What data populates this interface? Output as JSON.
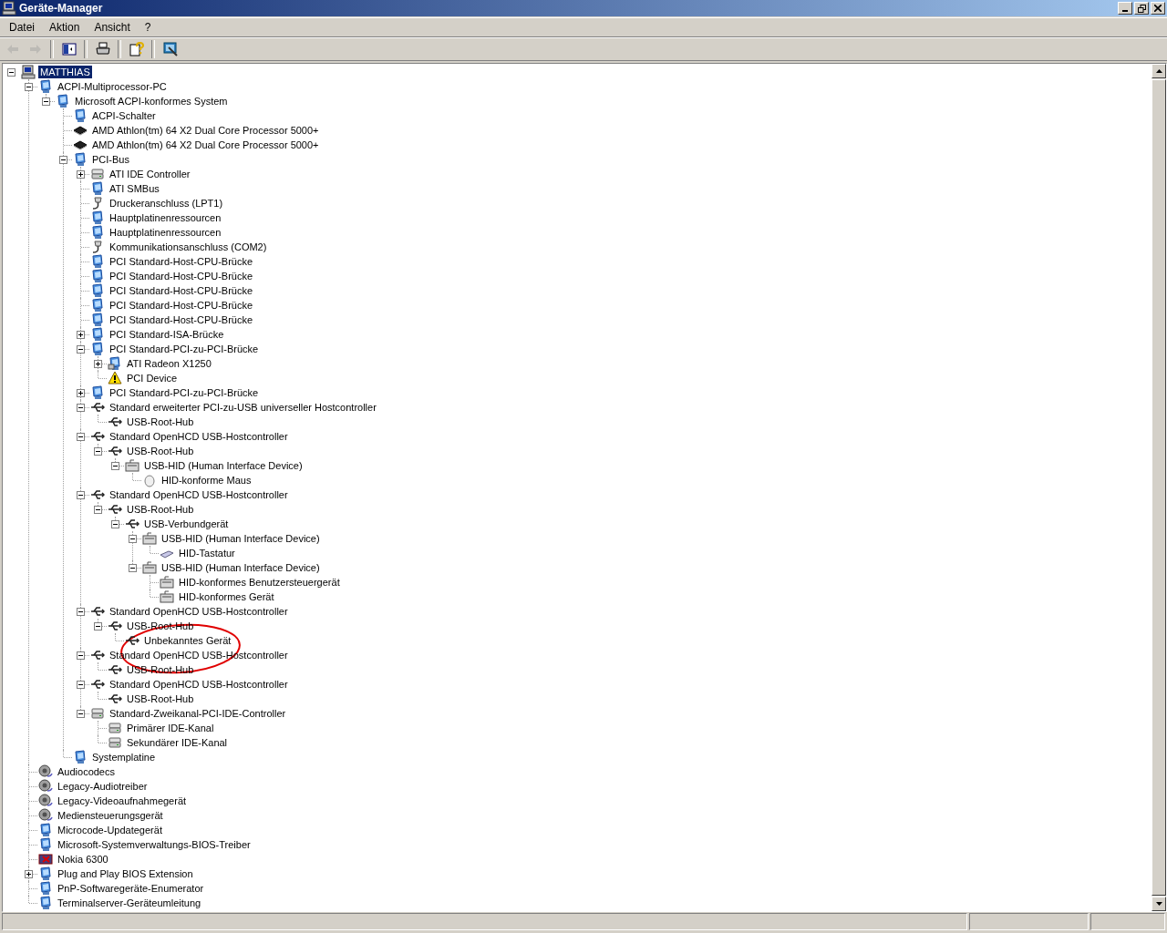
{
  "window": {
    "title": "Geräte-Manager"
  },
  "menu": [
    "Datei",
    "Aktion",
    "Ansicht",
    "?"
  ],
  "toolbar": [
    {
      "kind": "back",
      "disabled": true
    },
    {
      "kind": "forward",
      "disabled": true
    },
    {
      "kind": "tree",
      "disabled": false
    },
    {
      "kind": "print",
      "disabled": false
    },
    {
      "kind": "help",
      "disabled": false
    },
    {
      "kind": "scan",
      "disabled": false
    }
  ],
  "tree": [
    {
      "label": "MATTHIAS",
      "kind": "computer",
      "selected": true,
      "expanded": true,
      "children": [
        {
          "label": "ACPI-Multiprocessor-PC",
          "kind": "device",
          "selected": false,
          "expanded": true,
          "children": [
            {
              "label": "Microsoft ACPI-konformes System",
              "kind": "device",
              "selected": false,
              "expanded": true,
              "children": [
                {
                  "label": "ACPI-Schalter",
                  "kind": "device",
                  "selected": false
                },
                {
                  "label": "AMD Athlon(tm) 64 X2 Dual Core Processor 5000+",
                  "kind": "cpu",
                  "selected": false
                },
                {
                  "label": "AMD Athlon(tm) 64 X2 Dual Core Processor 5000+",
                  "kind": "cpu",
                  "selected": false
                },
                {
                  "label": "PCI-Bus",
                  "kind": "device",
                  "selected": false,
                  "expanded": true,
                  "children": [
                    {
                      "label": "ATI IDE Controller",
                      "kind": "ide",
                      "selected": false,
                      "expanded": false
                    },
                    {
                      "label": "ATI SMBus",
                      "kind": "device",
                      "selected": false
                    },
                    {
                      "label": "Druckeranschluss (LPT1)",
                      "kind": "port",
                      "selected": false
                    },
                    {
                      "label": "Hauptplatinenressourcen",
                      "kind": "device",
                      "selected": false
                    },
                    {
                      "label": "Hauptplatinenressourcen",
                      "kind": "device",
                      "selected": false
                    },
                    {
                      "label": "Kommunikationsanschluss (COM2)",
                      "kind": "port",
                      "selected": false
                    },
                    {
                      "label": "PCI Standard-Host-CPU-Brücke",
                      "kind": "device",
                      "selected": false
                    },
                    {
                      "label": "PCI Standard-Host-CPU-Brücke",
                      "kind": "device",
                      "selected": false
                    },
                    {
                      "label": "PCI Standard-Host-CPU-Brücke",
                      "kind": "device",
                      "selected": false
                    },
                    {
                      "label": "PCI Standard-Host-CPU-Brücke",
                      "kind": "device",
                      "selected": false
                    },
                    {
                      "label": "PCI Standard-Host-CPU-Brücke",
                      "kind": "device",
                      "selected": false
                    },
                    {
                      "label": "PCI Standard-ISA-Brücke",
                      "kind": "device",
                      "selected": false,
                      "expanded": false
                    },
                    {
                      "label": "PCI Standard-PCI-zu-PCI-Brücke",
                      "kind": "device",
                      "selected": false,
                      "expanded": true,
                      "children": [
                        {
                          "label": "ATI Radeon X1250",
                          "kind": "display",
                          "selected": false,
                          "expanded": false
                        },
                        {
                          "label": "PCI Device",
                          "kind": "warning",
                          "selected": false
                        }
                      ]
                    },
                    {
                      "label": "PCI Standard-PCI-zu-PCI-Brücke",
                      "kind": "device",
                      "selected": false,
                      "expanded": false
                    },
                    {
                      "label": "Standard erweiterter PCI-zu-USB universeller Hostcontroller",
                      "kind": "usb",
                      "selected": false,
                      "expanded": true,
                      "children": [
                        {
                          "label": "USB-Root-Hub",
                          "kind": "usb",
                          "selected": false
                        }
                      ]
                    },
                    {
                      "label": "Standard OpenHCD USB-Hostcontroller",
                      "kind": "usb",
                      "selected": false,
                      "expanded": true,
                      "children": [
                        {
                          "label": "USB-Root-Hub",
                          "kind": "usb",
                          "selected": false,
                          "expanded": true,
                          "children": [
                            {
                              "label": "USB-HID (Human Interface Device)",
                              "kind": "hid",
                              "selected": false,
                              "expanded": true,
                              "children": [
                                {
                                  "label": "HID-konforme Maus",
                                  "kind": "mouse",
                                  "selected": false
                                }
                              ]
                            }
                          ]
                        }
                      ]
                    },
                    {
                      "label": "Standard OpenHCD USB-Hostcontroller",
                      "kind": "usb",
                      "selected": false,
                      "expanded": true,
                      "children": [
                        {
                          "label": "USB-Root-Hub",
                          "kind": "usb",
                          "selected": false,
                          "expanded": true,
                          "children": [
                            {
                              "label": "USB-Verbundgerät",
                              "kind": "usb",
                              "selected": false,
                              "expanded": true,
                              "children": [
                                {
                                  "label": "USB-HID (Human Interface Device)",
                                  "kind": "hid",
                                  "selected": false,
                                  "expanded": true,
                                  "children": [
                                    {
                                      "label": "HID-Tastatur",
                                      "kind": "keyboard",
                                      "selected": false
                                    }
                                  ]
                                },
                                {
                                  "label": "USB-HID (Human Interface Device)",
                                  "kind": "hid",
                                  "selected": false,
                                  "expanded": true,
                                  "children": [
                                    {
                                      "label": "HID-konformes Benutzersteuergerät",
                                      "kind": "hid",
                                      "selected": false
                                    },
                                    {
                                      "label": "HID-konformes Gerät",
                                      "kind": "hid",
                                      "selected": false
                                    }
                                  ]
                                }
                              ]
                            }
                          ]
                        }
                      ]
                    },
                    {
                      "label": "Standard OpenHCD USB-Hostcontroller",
                      "kind": "usb",
                      "selected": false,
                      "expanded": true,
                      "children": [
                        {
                          "label": "USB-Root-Hub",
                          "kind": "usb",
                          "selected": false,
                          "expanded": true,
                          "children": [
                            {
                              "label": "Unbekanntes Gerät",
                              "kind": "usb",
                              "selected": false
                            }
                          ]
                        }
                      ]
                    },
                    {
                      "label": "Standard OpenHCD USB-Hostcontroller",
                      "kind": "usb",
                      "selected": false,
                      "expanded": true,
                      "children": [
                        {
                          "label": "USB-Root-Hub",
                          "kind": "usb",
                          "selected": false
                        }
                      ]
                    },
                    {
                      "label": "Standard OpenHCD USB-Hostcontroller",
                      "kind": "usb",
                      "selected": false,
                      "expanded": true,
                      "children": [
                        {
                          "label": "USB-Root-Hub",
                          "kind": "usb",
                          "selected": false
                        }
                      ]
                    },
                    {
                      "label": "Standard-Zweikanal-PCI-IDE-Controller",
                      "kind": "ide",
                      "selected": false,
                      "expanded": true,
                      "children": [
                        {
                          "label": "Primärer IDE-Kanal",
                          "kind": "ide",
                          "selected": false
                        },
                        {
                          "label": "Sekundärer IDE-Kanal",
                          "kind": "ide",
                          "selected": false
                        }
                      ]
                    }
                  ]
                },
                {
                  "label": "Systemplatine",
                  "kind": "device",
                  "selected": false
                }
              ]
            }
          ]
        },
        {
          "label": "Audiocodecs",
          "kind": "sound",
          "selected": false
        },
        {
          "label": "Legacy-Audiotreiber",
          "kind": "sound",
          "selected": false
        },
        {
          "label": "Legacy-Videoaufnahmegerät",
          "kind": "sound",
          "selected": false
        },
        {
          "label": "Mediensteuerungsgerät",
          "kind": "sound",
          "selected": false
        },
        {
          "label": "Microcode-Updategerät",
          "kind": "device",
          "selected": false
        },
        {
          "label": "Microsoft-Systemverwaltungs-BIOS-Treiber",
          "kind": "device",
          "selected": false
        },
        {
          "label": "Nokia 6300",
          "kind": "error",
          "selected": false
        },
        {
          "label": "Plug and Play BIOS Extension",
          "kind": "device",
          "selected": false,
          "expanded": false
        },
        {
          "label": "PnP-Softwaregeräte-Enumerator",
          "kind": "device",
          "selected": false
        },
        {
          "label": "Terminalserver-Geräteumleitung",
          "kind": "device",
          "selected": false
        }
      ]
    }
  ]
}
